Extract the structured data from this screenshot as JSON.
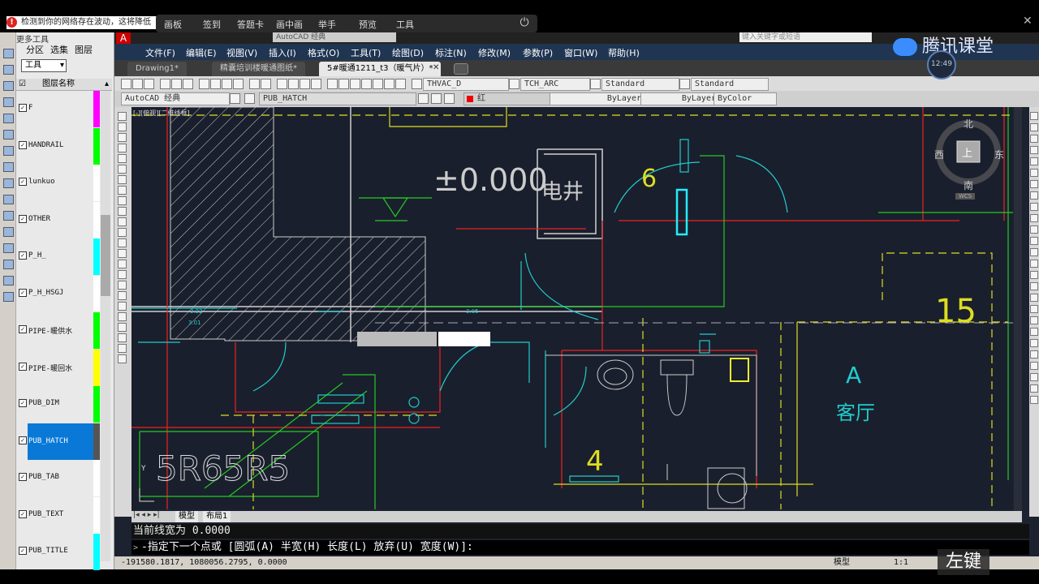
{
  "overlay": {
    "warning_text": "检测到你的网络存在波动，这将降低",
    "meeting_buttons": [
      "画板",
      "签到",
      "答题卡",
      "画中画",
      "举手",
      "预览",
      "工具"
    ],
    "brand": "腾讯课堂",
    "clock": "12:49",
    "left_key": "左键"
  },
  "layer_panel": {
    "title": "更多工具",
    "tabs": [
      "分区",
      "选集",
      "图层"
    ],
    "dropdown": "工具",
    "column_header": "图层名称",
    "layers": [
      {
        "name": "F",
        "color": "#ff00ff",
        "checked": true
      },
      {
        "name": "HANDRAIL",
        "color": "#00ff00",
        "checked": true
      },
      {
        "name": "lunkuo",
        "color": "#ffffff",
        "checked": true
      },
      {
        "name": "OTHER",
        "color": "#ffffff",
        "checked": true
      },
      {
        "name": "P_H_",
        "color": "#00ffff",
        "checked": true
      },
      {
        "name": "P_H_HSGJ",
        "color": "#ffffff",
        "checked": true
      },
      {
        "name": "PIPE-暖供水",
        "color": "#00ff00",
        "checked": true
      },
      {
        "name": "PIPE-暖回水",
        "color": "#ffff00",
        "checked": true
      },
      {
        "name": "PUB_DIM",
        "color": "#00ff00",
        "checked": true
      },
      {
        "name": "PUB_HATCH",
        "color": "#555555",
        "checked": true,
        "selected": true
      },
      {
        "name": "PUB_TAB",
        "color": "#ffffff",
        "checked": true
      },
      {
        "name": "PUB_TEXT",
        "color": "#ffffff",
        "checked": true
      },
      {
        "name": "PUB_TITLE",
        "color": "#00ffff",
        "checked": true
      }
    ]
  },
  "app": {
    "workspace": "AutoCAD 经典",
    "search_placeholder": "键入关键字或短语",
    "menus": [
      "文件(F)",
      "编辑(E)",
      "视图(V)",
      "插入(I)",
      "格式(O)",
      "工具(T)",
      "绘图(D)",
      "标注(N)",
      "修改(M)",
      "参数(P)",
      "窗口(W)",
      "帮助(H)"
    ],
    "file_tabs": [
      {
        "label": "Drawing1*",
        "active": false
      },
      {
        "label": "精囊培训楼暖通图纸*",
        "active": false
      },
      {
        "label": "5#暖通1211_t3（暖气片）*",
        "active": true
      }
    ],
    "styles": {
      "text": "THVAC_D",
      "dim": "TCH_ARC",
      "table": "Standard",
      "mleader": "Standard"
    },
    "props": {
      "workspace_combo": "AutoCAD 经典",
      "layer": "PUB_HATCH",
      "color": "红",
      "linetype": "ByLayer",
      "lineweight": "ByLayer",
      "plotstyle": "ByColor"
    },
    "viewport_label": "[-][俯视][二维线框]",
    "compass": {
      "n": "北",
      "s": "南",
      "e": "东",
      "w": "西",
      "center": "上",
      "wcs": "WCS"
    },
    "model_tabs": [
      "模型",
      "布局1"
    ],
    "command_lines": [
      "当前线宽为 0.0000",
      "-指定下一个点或 [圆弧(A) 半宽(H) 长度(L) 放弃(U) 宽度(W)]:"
    ],
    "coords": "-191580.1817, 1080056.2795, 0.0000",
    "status_right": [
      "模型",
      "1:1"
    ]
  },
  "drawing": {
    "elevation": "±0.000",
    "room_elec": "电井",
    "room_living": "客厅",
    "axis_a": "A",
    "grid_15": "15",
    "num_6": "6",
    "num_4": "4",
    "dim_a": "3.22",
    "dim_b": "3.01",
    "dim_c": "3.05",
    "big_text": "5R65R5"
  }
}
